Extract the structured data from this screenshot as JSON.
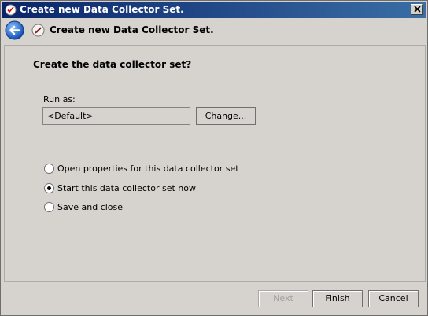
{
  "window": {
    "title": "Create new Data Collector Set."
  },
  "wizard": {
    "title": "Create new Data Collector Set.",
    "heading": "Create the data collector set?"
  },
  "run_as": {
    "label": "Run as:",
    "value": "<Default>",
    "change_label": "Change..."
  },
  "options": [
    {
      "label": "Open properties for this data collector set",
      "selected": false
    },
    {
      "label": "Start this data collector set now",
      "selected": true
    },
    {
      "label": "Save and close",
      "selected": false
    }
  ],
  "footer": {
    "next_label": "Next",
    "next_enabled": false,
    "finish_label": "Finish",
    "cancel_label": "Cancel"
  },
  "icons": {
    "app": "performance-monitor-icon",
    "back": "back-arrow-icon",
    "wizard": "data-collector-icon",
    "close": "close-icon"
  },
  "colors": {
    "titlebar_start": "#0a246a",
    "titlebar_end": "#3a6ea5",
    "back_button": "#1e6fd9"
  }
}
